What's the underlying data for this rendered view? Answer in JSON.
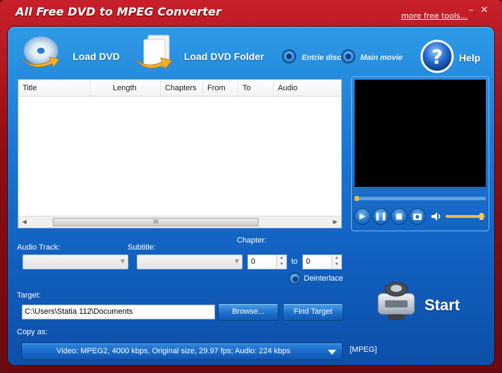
{
  "window": {
    "title": "All Free DVD to MPEG Converter",
    "more_tools": "more free tools...",
    "minimize": "–",
    "close": "✕"
  },
  "toolbar": {
    "load_dvd": "Load DVD",
    "load_folder": "Load DVD Folder",
    "entire_disc": "Entrie disc",
    "main_movie": "Main movie",
    "help": "Help"
  },
  "list": {
    "columns": [
      "Title",
      "Length",
      "Chapters",
      "From",
      "To",
      "Audio"
    ],
    "scroll_grip": "III"
  },
  "form": {
    "audio_track_label": "Audio Track:",
    "subtitle_label": "Subtitle:",
    "chapter_label": "Chapter:",
    "chapter_from": "0",
    "to_label": "to",
    "chapter_to": "0",
    "deinterlace_label": "Deinterlace",
    "target_label": "Target:",
    "target_path": "C:\\Users\\Statia 112\\Documents",
    "browse": "Browse...",
    "find_target": "Find Target",
    "copy_as_label": "Copy as:",
    "format_value": "Video: MPEG2, 4000 kbps, Original size, 29.97 fps; Audio: 224 kbps",
    "format_tag": "[MPEG]"
  },
  "player": {
    "progress": 0.0,
    "volume": 0.95
  },
  "start": "Start",
  "colors": {
    "frame": "#b01a24",
    "panel": "#1a78d6",
    "accent": "#f5b740"
  }
}
